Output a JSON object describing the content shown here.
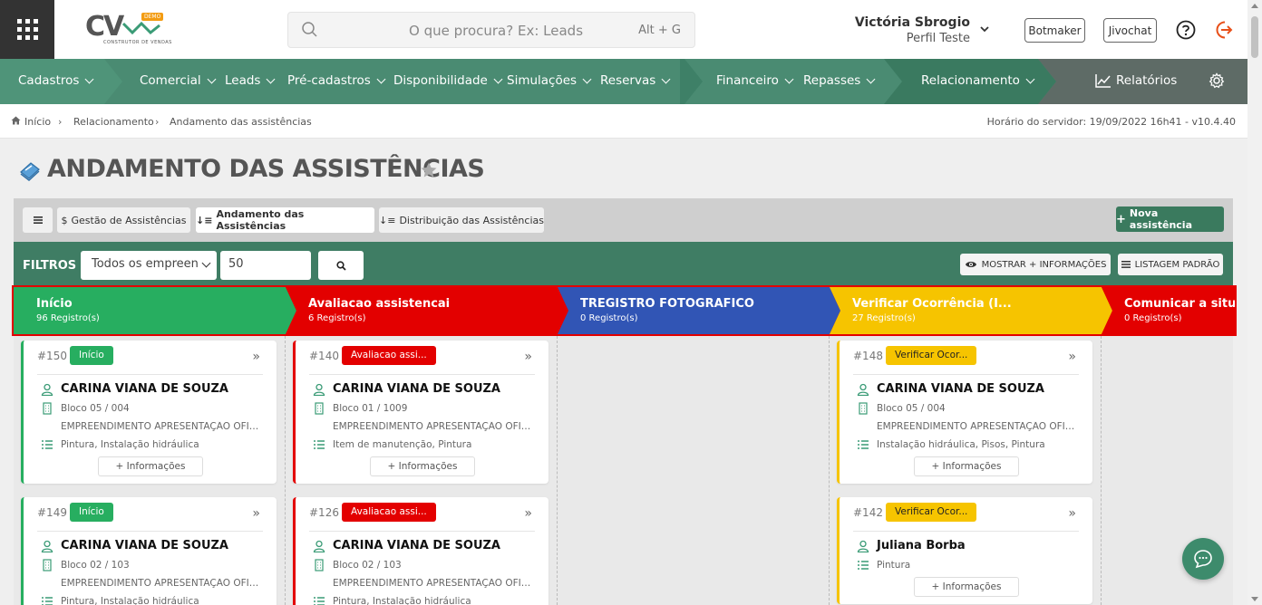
{
  "header": {
    "logo_text": "CV",
    "logo_badge": "DEMO",
    "logo_subtitle": "CONSTRUTOR DE VENDAS",
    "search_placeholder": "O que procura? Ex: Leads",
    "search_shortcut": "Alt + G",
    "user_name": "Victória Sbrogio",
    "user_profile": "Perfil Teste",
    "btn_botmaker": "Botmaker",
    "btn_jivochat": "Jivochat"
  },
  "nav": {
    "items": [
      {
        "label": "Cadastros"
      },
      {
        "label": "Comercial"
      },
      {
        "label": "Leads"
      },
      {
        "label": "Pré-cadastros"
      },
      {
        "label": "Disponibilidade"
      },
      {
        "label": "Simulações"
      },
      {
        "label": "Reservas"
      },
      {
        "label": "Financeiro"
      },
      {
        "label": "Repasses"
      },
      {
        "label": "Relacionamento"
      }
    ],
    "reports_label": "Relatórios"
  },
  "breadcrumb": {
    "items": [
      "Início",
      "Relacionamento",
      "Andamento das assistências"
    ],
    "server_time": "Horário do servidor: 19/09/2022 16h41 - v10.4.40"
  },
  "page": {
    "title": "ANDAMENTO DAS ASSISTÊNCIAS"
  },
  "toolbar": {
    "tabs": [
      {
        "label": "Gestão de Assistências",
        "prefix": "$"
      },
      {
        "label": "Andamento das Assistências",
        "prefix": "↓≡"
      },
      {
        "label": "Distribuição das Assistências",
        "prefix": "↓≡"
      }
    ],
    "new_button": "Nova assistência"
  },
  "filters": {
    "label": "FILTROS",
    "enterprise_value": "Todos os empreen",
    "quantity_value": "50",
    "show_info_button": "MOSTRAR + INFORMAÇÕES",
    "standard_list_button": "LISTAGEM PADRÃO"
  },
  "stages": [
    {
      "name": "Início",
      "count": "96 Registro(s)",
      "color": "#27ae60"
    },
    {
      "name": "Avaliacao assistencai",
      "count": "6 Registro(s)",
      "color": "#e30000"
    },
    {
      "name": "TREGISTRO FOTOGRAFICO",
      "count": "0 Registro(s)",
      "color": "#3155b5"
    },
    {
      "name": "Verificar Ocorrência (I...",
      "count": "27 Registro(s)",
      "color": "#f6c400"
    },
    {
      "name": "Comunicar a situa",
      "count": "0 Registro(s)",
      "color": "#e30000"
    }
  ],
  "cards": [
    {
      "id": "#150",
      "badge": "Início",
      "name": "CARINA VIANA DE SOUZA",
      "unit": "Bloco 05 / 004",
      "enterprise": "EMPREENDIMENTO APRESENTAÇÃO OFICIAL",
      "services": "Pintura, Instalação hidráulica",
      "info": "+ Informações"
    },
    {
      "id": "#149",
      "badge": "Início",
      "name": "CARINA VIANA DE SOUZA",
      "unit": "Bloco 02 / 103",
      "enterprise": "EMPREENDIMENTO APRESENTAÇÃO OFICIAL",
      "services": "Pintura, Instalação hidráulica",
      "info": "+ Informações"
    },
    {
      "id": "#140",
      "badge": "Avaliacao assi...",
      "name": "CARINA VIANA DE SOUZA",
      "unit": "Bloco 01 / 1009",
      "enterprise": "EMPREENDIMENTO APRESENTAÇÃO OFICIAL",
      "services": "Item de manutenção, Pintura",
      "info": "+ Informações"
    },
    {
      "id": "#126",
      "badge": "Avaliacao assi...",
      "name": "CARINA VIANA DE SOUZA",
      "unit": "Bloco 02 / 103",
      "enterprise": "EMPREENDIMENTO APRESENTAÇÃO OFICIAL",
      "services": "Pintura, Instalação hidráulica",
      "info": "+ Informações"
    },
    {
      "id": "#148",
      "badge": "Verificar Ocor...",
      "name": "CARINA VIANA DE SOUZA",
      "unit": "Bloco 05 / 004",
      "enterprise": "EMPREENDIMENTO APRESENTAÇÃO OFICIAL",
      "services": "Instalação hidráulica, Pisos, Pintura",
      "info": "+ Informações"
    },
    {
      "id": "#142",
      "badge": "Verificar Ocor...",
      "name": "Juliana Borba",
      "services": "Pintura",
      "info": "+ Informações"
    }
  ]
}
